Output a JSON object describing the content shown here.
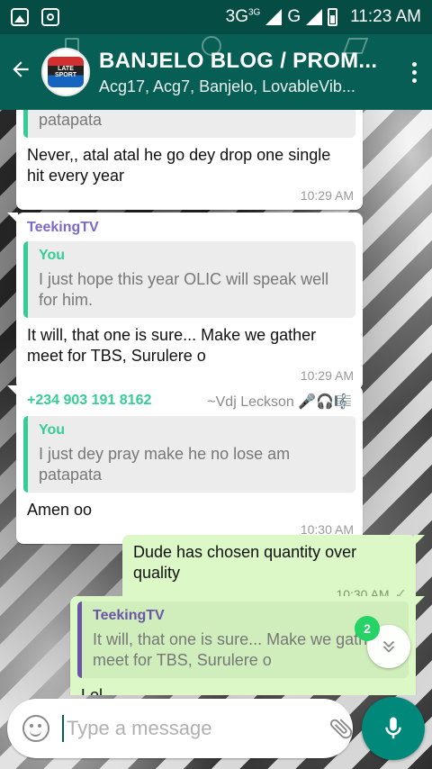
{
  "status_bar": {
    "network_label": "3G",
    "network_sup": "3G",
    "network2_label": "G",
    "time": "11:23 AM"
  },
  "header": {
    "back_icon": "arrow-left-icon",
    "avatar_logo_text": "LATE SPORT",
    "title": "BANJELO BLOG / PROM...",
    "subtitle": "Acg17, Acg7, Banjelo, LovableVib..."
  },
  "messages": [
    {
      "id": "m1",
      "direction": "in",
      "quote": {
        "name": "",
        "text": "I just dey pray make he no lose am patapata"
      },
      "text": "Never,, atal atal he go dey drop one single hit every year",
      "time": "10:29 AM"
    },
    {
      "id": "m2",
      "direction": "in",
      "sender": "TeekingTV",
      "sender_color": "#7b68c9",
      "quote": {
        "name": "You",
        "text": "I just hope this year OLIC will speak well for him."
      },
      "text": "It will, that one is sure... Make we gather meet for TBS, Surulere o",
      "time": "10:29 AM"
    },
    {
      "id": "m3",
      "direction": "in",
      "sender": "+234 903 191 8162",
      "sender_color": "#35cd96",
      "sender_alias": "~Vdj Leckson 🎤🎧🎼",
      "quote": {
        "name": "You",
        "text": "I just dey pray make he no lose am patapata"
      },
      "text": "Amen oo",
      "time": "10:30 AM"
    },
    {
      "id": "m4",
      "direction": "out",
      "text": "Dude has chosen quantity over quality",
      "time": "10:30 AM"
    },
    {
      "id": "m5",
      "direction": "out",
      "quote": {
        "name": "TeekingTV",
        "text": "It will, that one is sure... Make we gather meet for TBS, Surulere o"
      },
      "text": "Lol"
    }
  ],
  "unread_badge": "2",
  "composer": {
    "placeholder": "Type a message"
  },
  "colors": {
    "toolbar": "#075e54",
    "status_bar": "#054d44",
    "outgoing_bubble": "#dcf8c6",
    "incoming_bubble": "#ffffff",
    "fab": "#00897b"
  }
}
